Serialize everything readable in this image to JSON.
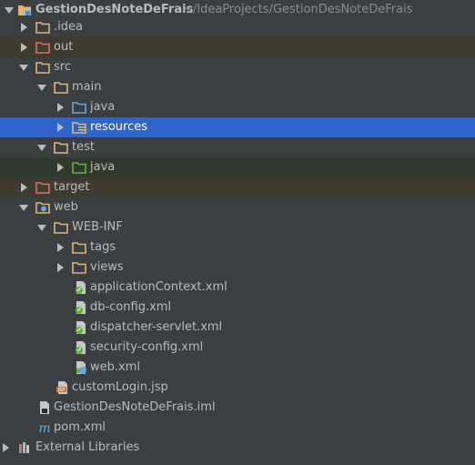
{
  "project_tree": {
    "root": {
      "label": "GestionDesNoteDeFrais",
      "path": "~/IdeaProjects/GestionDesNoteDeFrais",
      "icon": "module-folder-icon"
    },
    "items": [
      {
        "label": ".idea",
        "icon": "folder-icon"
      },
      {
        "label": "out",
        "icon": "excluded-folder-icon"
      },
      {
        "label": "src",
        "icon": "folder-icon"
      },
      {
        "label": "main",
        "icon": "folder-icon"
      },
      {
        "label": "java",
        "icon": "source-folder-icon"
      },
      {
        "label": "resources",
        "icon": "resources-folder-icon"
      },
      {
        "label": "test",
        "icon": "folder-icon"
      },
      {
        "label": "java",
        "icon": "test-source-folder-icon"
      },
      {
        "label": "target",
        "icon": "excluded-folder-icon"
      },
      {
        "label": "web",
        "icon": "web-folder-icon"
      },
      {
        "label": "WEB-INF",
        "icon": "folder-icon"
      },
      {
        "label": "tags",
        "icon": "folder-icon"
      },
      {
        "label": "views",
        "icon": "folder-icon"
      },
      {
        "label": "applicationContext.xml",
        "icon": "spring-xml-file-icon"
      },
      {
        "label": "db-config.xml",
        "icon": "spring-xml-file-icon"
      },
      {
        "label": "dispatcher-servlet.xml",
        "icon": "spring-xml-file-icon"
      },
      {
        "label": "security-config.xml",
        "icon": "spring-xml-file-icon"
      },
      {
        "label": "web.xml",
        "icon": "web-xml-file-icon"
      },
      {
        "label": "customLogin.jsp",
        "icon": "jsp-file-icon"
      },
      {
        "label": "GestionDesNoteDeFrais.iml",
        "icon": "iml-file-icon"
      },
      {
        "label": "pom.xml",
        "icon": "maven-file-icon"
      },
      {
        "label": "External Libraries",
        "icon": "libraries-icon"
      }
    ]
  },
  "colors": {
    "background": "#3c3f41",
    "selection": "#2f65ca",
    "excluded_row": "#3f3b2f",
    "test_row": "#303a2d",
    "folder": "#dcb67a",
    "excluded_folder": "#d9706c",
    "source_folder": "#6ba6d4",
    "test_folder": "#62b543"
  }
}
